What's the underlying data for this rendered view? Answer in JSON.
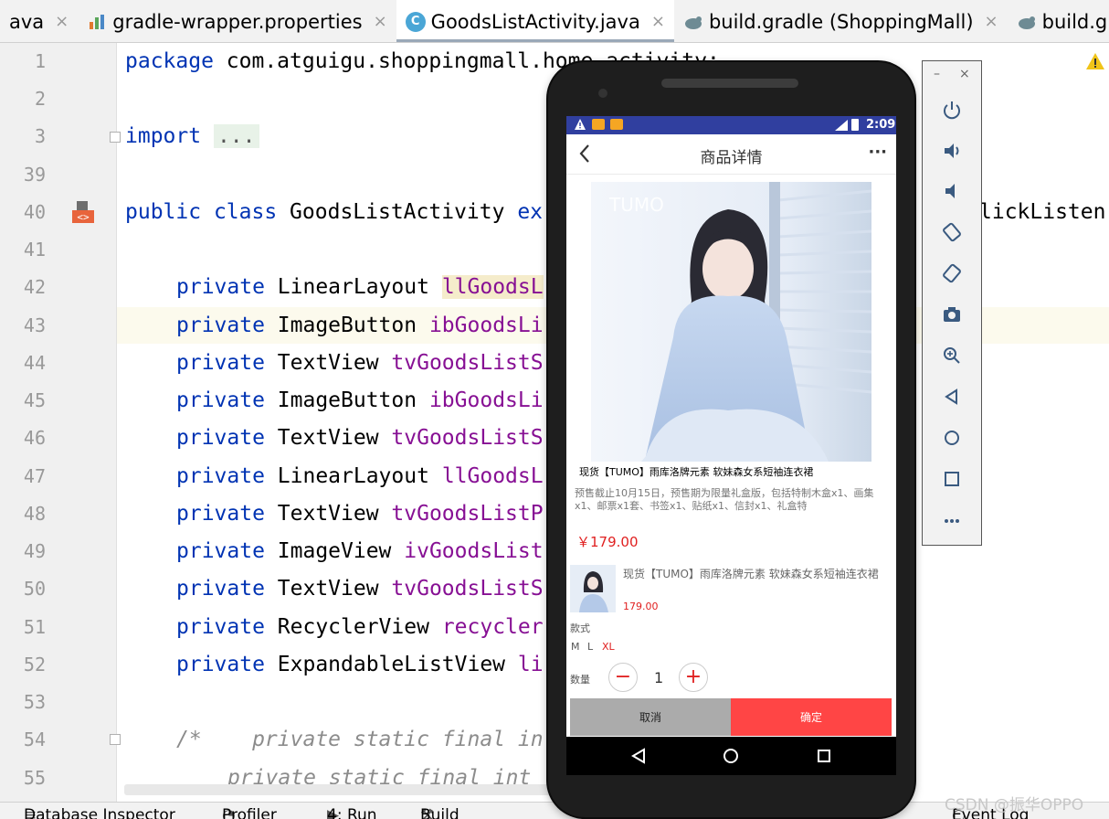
{
  "tabs": [
    {
      "label": "ava",
      "icon": "none",
      "active": false
    },
    {
      "label": "gradle-wrapper.properties",
      "icon": "properties-file-icon",
      "active": false
    },
    {
      "label": "GoodsListActivity.java",
      "icon": "java-class-icon",
      "active": true
    },
    {
      "label": "build.gradle (ShoppingMall)",
      "icon": "gradle-icon",
      "active": false
    },
    {
      "label": "build.gradle (:ap",
      "icon": "gradle-icon",
      "active": false
    }
  ],
  "tab_close_glyph": "×",
  "line_numbers": [
    "1",
    "2",
    "3",
    "39",
    "40",
    "41",
    "42",
    "43",
    "44",
    "45",
    "46",
    "47",
    "48",
    "49",
    "50",
    "51",
    "52",
    "53",
    "54",
    "55"
  ],
  "code": {
    "l1_kw": "package",
    "l1_rest": " com.atguigu.shoppingmall.home.activity;",
    "l3_kw": "import",
    "l3_fold": "...",
    "l40_kw1": "public",
    "l40_kw2": "class",
    "l40_name": " GoodsListActivity ",
    "l40_kw3": "ex",
    "l40_tail": "lickListen",
    "private": "private",
    "l42_type": " LinearLayout ",
    "l42_field": "llGoodsL",
    "l43_type": " ImageButton ",
    "l43_field": "ibGoodsLi",
    "l44_type": " TextView ",
    "l44_field": "tvGoodsListS",
    "l45_type": " ImageButton ",
    "l45_field": "ibGoodsLi",
    "l46_type": " TextView ",
    "l46_field": "tvGoodsListS",
    "l47_type": " LinearLayout ",
    "l47_field": "llGoodsL",
    "l48_type": " TextView ",
    "l48_field": "tvGoodsListP",
    "l49_type": " ImageView ",
    "l49_field": "ivGoodsList",
    "l50_type": " TextView ",
    "l50_field": "tvGoodsListS",
    "l51_type": " RecyclerView ",
    "l51_field": "recycler",
    "l52_type": " ExpandableListView ",
    "l52_field": "li",
    "l54": "/*    private static final in",
    "l55": "private static final int"
  },
  "bottom_tools": [
    "Database Inspector",
    "Profiler",
    "4: Run",
    "Build",
    "Event Log"
  ],
  "watermark": "CSDN @振华OPPO",
  "phone": {
    "status_time": "2:09",
    "title": "商品详情",
    "back_glyph": "<",
    "more_glyph": "···",
    "image_brand": "TUMO",
    "product_name": "现货【TUMO】雨库洛牌元素 软妹森女系短袖连衣裙",
    "product_desc": "预售截止10月15日，预售期为限量礼盒版，包括特制木盒x1、画集x1、邮票x1套、书签x1、贴纸x1、信封x1、礼盒特",
    "product_price": "￥179.00",
    "sku_name": "现货【TUMO】雨库洛牌元素 软妹森女系短袖连衣裙",
    "sku_price": "179.00",
    "style_label": "款式",
    "options": [
      "M",
      "L",
      "XL"
    ],
    "selected_option": "XL",
    "qty_label": "数量",
    "minus": "−",
    "plus": "+",
    "quantity": "1",
    "cancel": "取消",
    "confirm": "确定"
  },
  "colors": {
    "status_bar": "#303f9f",
    "price": "#e02020",
    "confirm_button": "#ff4545",
    "cancel_button": "#ababab",
    "keyword": "#0033b3",
    "field": "#871094"
  }
}
